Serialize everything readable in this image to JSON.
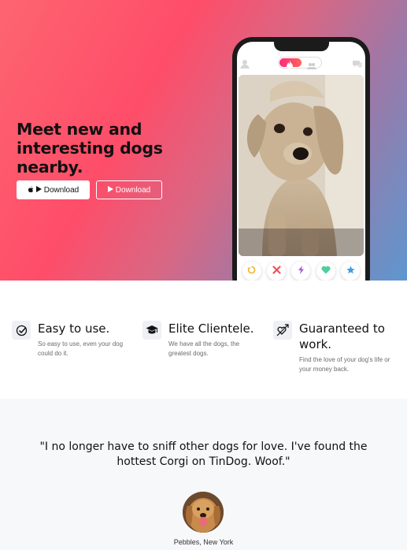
{
  "hero": {
    "title": "Meet new and interesting dogs nearby.",
    "download_apple": "Download",
    "download_google": "Download"
  },
  "phone": {
    "icons": [
      "user-icon",
      "flame-icon",
      "group-icon",
      "chat-icon"
    ],
    "actions": [
      "undo-icon",
      "close-icon",
      "bolt-icon",
      "heart-icon",
      "star-icon"
    ]
  },
  "features": [
    {
      "icon": "check-circle-icon",
      "title": "Easy to use.",
      "text": "So easy to use, even your dog could do it."
    },
    {
      "icon": "graduation-cap-icon",
      "title": "Elite Clientele.",
      "text": "We have all the dogs, the greatest dogs."
    },
    {
      "icon": "heart-arrow-icon",
      "title": "Guaranteed to work.",
      "text": "Find the love of your dog's life or your money back."
    }
  ],
  "testimonial": {
    "quote": "\"I no longer have to sniff other dogs for love. I've found the hottest Corgi on TinDog. Woof.\"",
    "author": "Pebbles, New York"
  },
  "colors": {
    "brand_red": "#fe4d69",
    "brand_blue": "#5d97cf"
  }
}
